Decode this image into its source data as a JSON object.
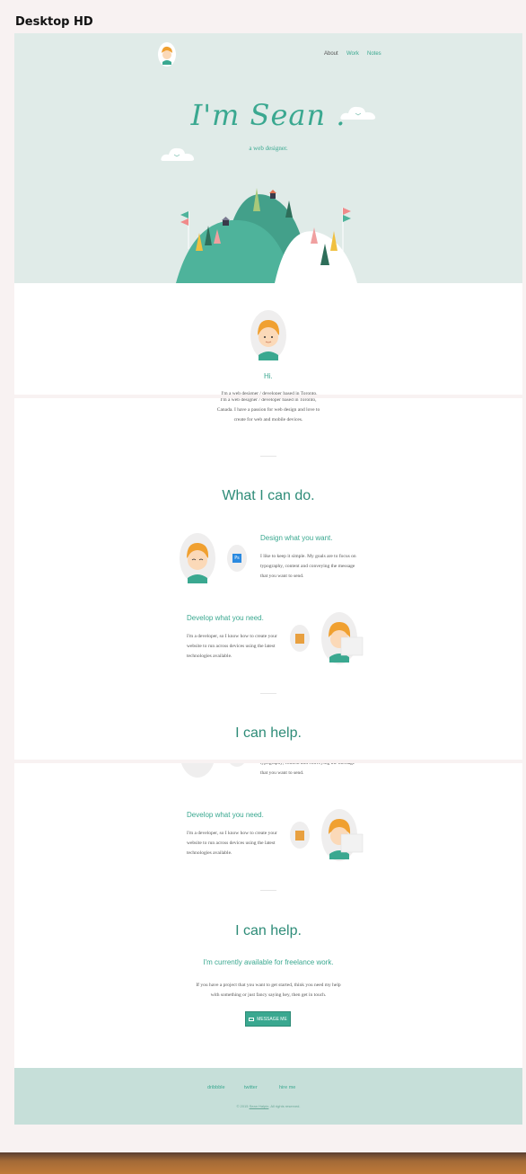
{
  "frame_label": "Desktop HD",
  "nav": {
    "about": "About",
    "work": "Work",
    "notes": "Notes"
  },
  "hero": {
    "title": "I'm Sean .",
    "subtitle": "a web designer."
  },
  "intro": {
    "heading": "Hi.",
    "text_line1": "I'm a web designer / developer based in Toronto,",
    "text_line2": "Canada. I have a passion for web design and love to",
    "text_line3": "create for web and mobile devices."
  },
  "skills": {
    "title": "What I can do.",
    "design_heading": "Design what you want.",
    "design_line1": "I like to keep it simple. My goals are to focus on",
    "design_line2": "typography, content and conveying the message",
    "design_line3": "that you want to send.",
    "ps_badge": "Ps",
    "develop_heading": "Develop what you need.",
    "develop_line1": "I'm a developer, so I know how to create your",
    "develop_line2": "website to run across devices using the latest",
    "develop_line3": "technologies available."
  },
  "help": {
    "title": "I can help.",
    "subheading": "I'm currently available for freelance work.",
    "text_line1": "If you have a project that you want to get started, think you need my help",
    "text_line2": "with something or just fancy saying hey, then get in touch.",
    "button_label": "MESSAGE ME"
  },
  "footer": {
    "links": [
      "dribbble",
      "twitter",
      "hire me"
    ],
    "copyright_prefix": "© 2015",
    "copyright_name": "Sean Halpin",
    "copyright_suffix": ". All rights reserved."
  },
  "colors": {
    "accent": "#3aa890",
    "hero_bg": "#e0ebe8",
    "footer_bg": "#c6dfd9"
  }
}
